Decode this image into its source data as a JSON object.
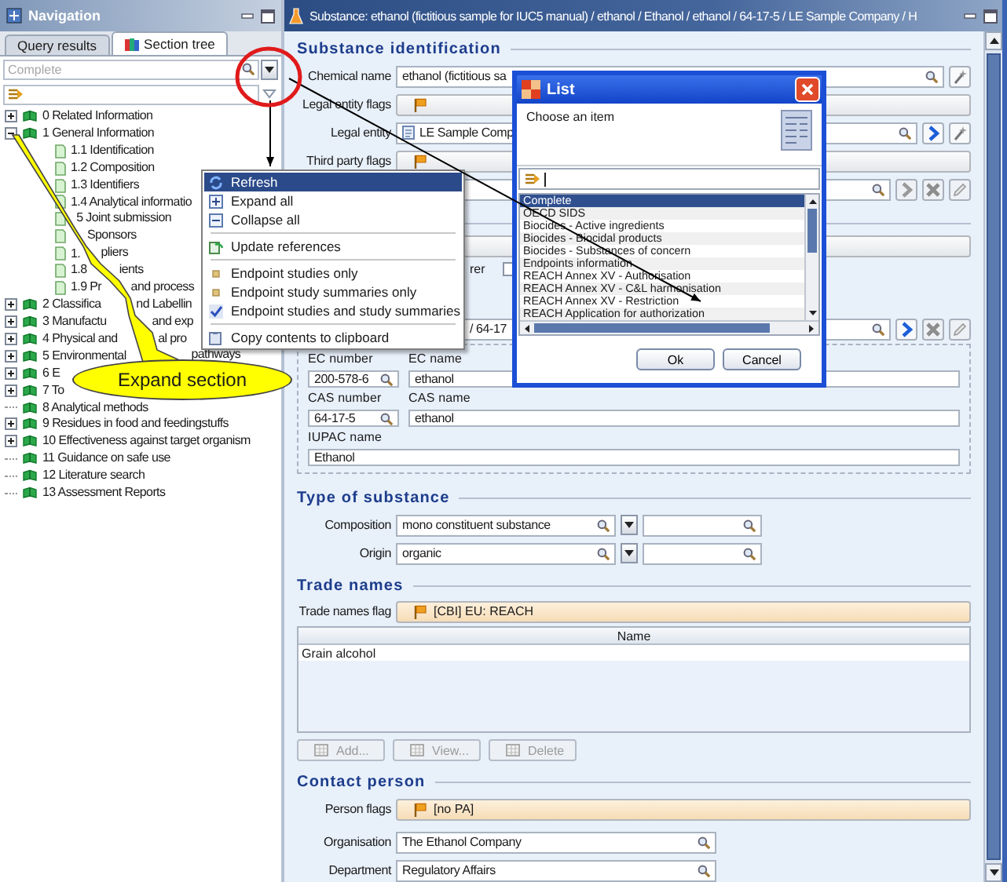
{
  "navigation": {
    "title": "Navigation",
    "tabs": [
      {
        "label": "Query results",
        "selected": false
      },
      {
        "label": "Section tree",
        "selected": true
      }
    ],
    "search": {
      "placeholder": "Complete"
    },
    "tree": [
      {
        "label": "0 Related Information",
        "kind": "group",
        "expanded": false
      },
      {
        "label": "1 General Information",
        "kind": "group",
        "expanded": true,
        "children": [
          {
            "label": "1.1 Identification"
          },
          {
            "label": "1.2 Composition"
          },
          {
            "label": "1.3 Identifiers"
          },
          {
            "label": "1.4 Analytical informatio"
          },
          {
            "tail": "5 Joint submission"
          },
          {
            "tail": "Sponsors"
          },
          {
            "label": "1.",
            "tail": "pliers"
          },
          {
            "label": "1.8",
            "tail": "ients"
          },
          {
            "label": "1.9 Pr",
            "tail": "and process"
          }
        ]
      },
      {
        "label": "2 Classifica",
        "tail": "nd Labellin",
        "kind": "group",
        "expanded": false
      },
      {
        "label": "3 Manufactu",
        "tail": "and exp",
        "kind": "group",
        "expanded": false
      },
      {
        "label": "4 Physical and",
        "tail": "al pro",
        "kind": "group",
        "expanded": false
      },
      {
        "label": "5 Environmental",
        "tail": "pathways",
        "kind": "group",
        "expanded": false
      },
      {
        "label": "6 E",
        "kind": "group",
        "expanded": false
      },
      {
        "label": "7 To",
        "kind": "group",
        "expanded": false
      },
      {
        "label": "8 Analytical methods",
        "kind": "leaf"
      },
      {
        "label": "9 Residues in food and feedingstuffs",
        "kind": "group",
        "expanded": false
      },
      {
        "label": "10 Effectiveness against target organism",
        "kind": "group",
        "expanded": false
      },
      {
        "label": "11 Guidance on safe use",
        "kind": "leaf"
      },
      {
        "label": "12 Literature search",
        "kind": "leaf"
      },
      {
        "label": "13 Assessment Reports",
        "kind": "leaf"
      }
    ]
  },
  "editor": {
    "title": "Substance: ethanol (fictitious sample for IUC5 manual) / ethanol / Ethanol / ethanol / 64-17-5 / LE Sample Company / H",
    "identification": {
      "heading": "Substance identification",
      "chemical_name": {
        "label": "Chemical name",
        "value": "ethanol (fictitious sa"
      },
      "legal_entity_flags": {
        "label": "Legal entity flags"
      },
      "legal_entity": {
        "label": "Legal entity",
        "value": "LE Sample Comp"
      },
      "third_party_flags": {
        "label": "Third party flags"
      },
      "manufacturer": {
        "text": "rer",
        "checked": false
      },
      "reference": {
        "value": "/ 64-17"
      },
      "identifiers": [
        {
          "label": "EC number",
          "value": "200-578-6",
          "kind": "lookup"
        },
        {
          "label": "EC name",
          "value": "ethanol",
          "kind": "text"
        },
        {
          "label": "CAS number",
          "value": "64-17-5",
          "kind": "lookup"
        },
        {
          "label": "CAS name",
          "value": "ethanol",
          "kind": "text"
        },
        {
          "label": "IUPAC name",
          "value": "Ethanol",
          "kind": "wide"
        }
      ]
    },
    "type_of_substance": {
      "heading": "Type of substance",
      "rows": [
        {
          "label": "Composition",
          "value": "mono constituent substance"
        },
        {
          "label": "Origin",
          "value": "organic"
        }
      ]
    },
    "trade_names": {
      "heading": "Trade names",
      "flag": {
        "label": "Trade names flag",
        "value": "[CBI] EU: REACH"
      },
      "table": {
        "columns": [
          "Name"
        ],
        "rows": [
          [
            "Grain alcohol"
          ]
        ]
      },
      "buttons": [
        {
          "label": "Add...",
          "disabled": true
        },
        {
          "label": "View...",
          "disabled": true
        },
        {
          "label": "Delete",
          "disabled": true
        }
      ]
    },
    "contact_person": {
      "heading": "Contact person",
      "person_flags": {
        "label": "Person flags",
        "value": "[no PA]"
      },
      "fields": [
        {
          "label": "Organisation",
          "value": "The Ethanol Company"
        },
        {
          "label": "Department",
          "value": "Regulatory Affairs"
        }
      ]
    }
  },
  "context_menu": {
    "items": [
      {
        "kind": "action",
        "label": "Refresh",
        "selected": true
      },
      {
        "kind": "action",
        "label": "Expand all",
        "selected": false
      },
      {
        "kind": "action",
        "label": "Collapse all",
        "selected": false
      },
      {
        "kind": "separator"
      },
      {
        "kind": "action",
        "label": "Update references",
        "selected": false
      },
      {
        "kind": "separator"
      },
      {
        "kind": "option",
        "label": "Endpoint studies only",
        "checked": false,
        "selected": false
      },
      {
        "kind": "option",
        "label": "Endpoint study summaries only",
        "checked": false,
        "selected": false
      },
      {
        "kind": "option",
        "label": "Endpoint studies and study summaries",
        "checked": true,
        "selected": false
      },
      {
        "kind": "separator"
      },
      {
        "kind": "action",
        "label": "Copy contents to clipboard",
        "selected": false
      }
    ]
  },
  "list_dialog": {
    "title": "List",
    "prompt": "Choose an item",
    "items": [
      {
        "label": "Complete",
        "selected": true
      },
      {
        "label": "OECD SIDS",
        "selected": false
      },
      {
        "label": "Biocides - Active ingredients",
        "selected": false
      },
      {
        "label": "Biocides - Biocidal products",
        "selected": false
      },
      {
        "label": "Biocides - Substances of concern",
        "selected": false
      },
      {
        "label": "Endpoints information",
        "selected": false
      },
      {
        "label": "REACH Annex XV - Authorisation",
        "selected": false
      },
      {
        "label": "REACH Annex XV - C&L harmonisation",
        "selected": false
      },
      {
        "label": "REACH Annex XV - Restriction",
        "selected": false
      },
      {
        "label": "REACH Application for authorization",
        "selected": false
      }
    ],
    "buttons": [
      "Ok",
      "Cancel"
    ]
  },
  "annotation": {
    "callout": "Expand section"
  }
}
